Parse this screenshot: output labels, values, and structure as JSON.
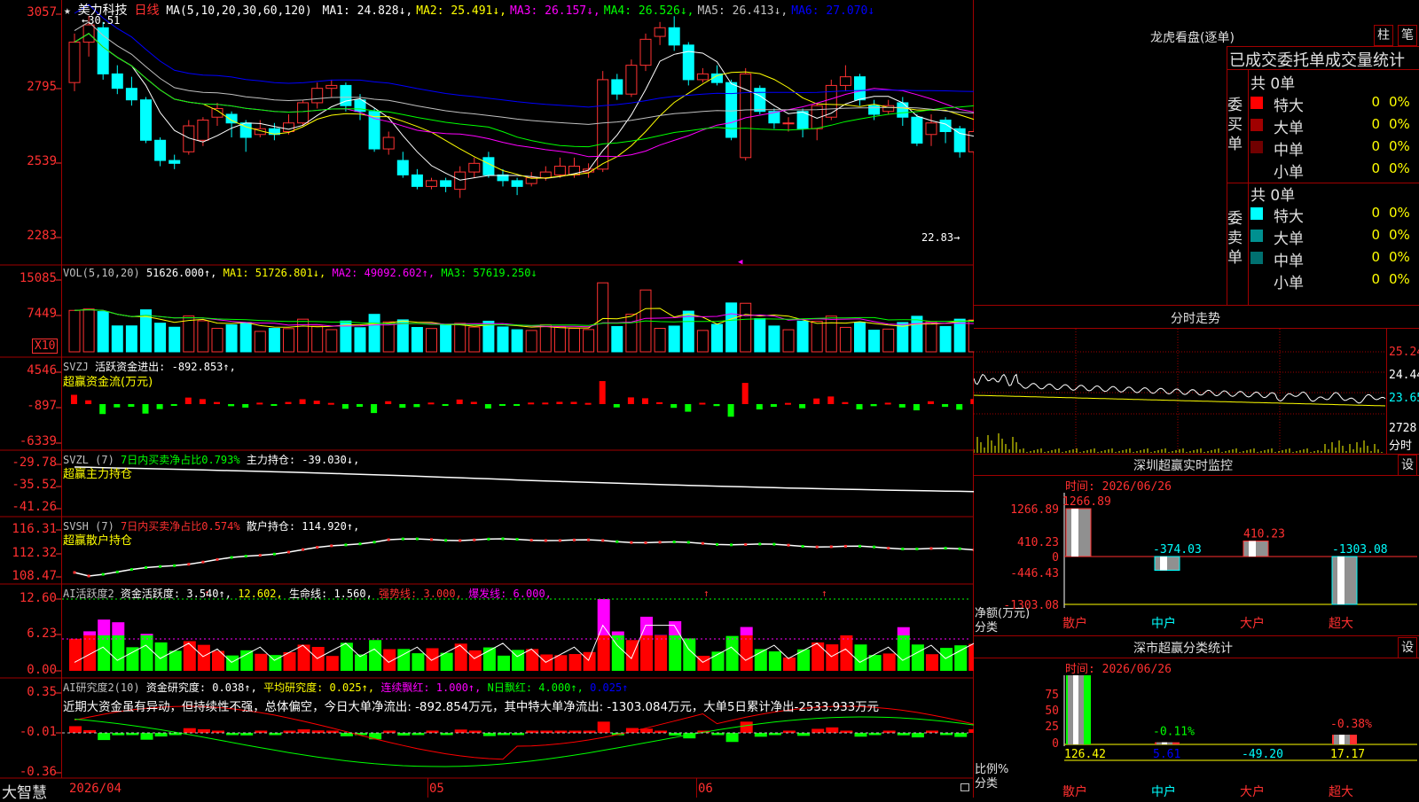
{
  "header": {
    "star": "★",
    "stock_name": "美力科技",
    "period": "日线",
    "ma_params": "MA(5,10,20,30,60,120)",
    "ma_items": [
      {
        "label": "MA1: 24.828↓,",
        "color": "#ffffff"
      },
      {
        "label": "MA2: 25.491↓,",
        "color": "#ffff00"
      },
      {
        "label": "MA3: 26.157↓,",
        "color": "#ff00ff"
      },
      {
        "label": "MA4: 26.526↓,",
        "color": "#00ff00"
      },
      {
        "label": "MA5: 26.413↓,",
        "color": "#c0c0c0"
      },
      {
        "label": "MA6: 27.070↓",
        "color": "#0000ff"
      }
    ],
    "high_marker": "←30.51",
    "low_marker": "22.83→"
  },
  "price_axis": [
    "3057",
    "2795",
    "2539",
    "2283"
  ],
  "vol": {
    "header": "VOL(5,10,20)",
    "value": "51626.000↑,",
    "ma1": "MA1: 51726.801↓,",
    "ma2": "MA2: 49092.602↑,",
    "ma3": "MA3: 57619.250↓",
    "axis": [
      "15085",
      "7449"
    ],
    "unit": "X10"
  },
  "svzj": {
    "name": "SVZJ",
    "label1": "活跃资金进出: -892.853↑,",
    "label2": "超赢资金流(万元)",
    "axis": [
      "4546",
      "-897",
      "-6339"
    ]
  },
  "svzl": {
    "name": "SVZL (7)",
    "label1": "7日内买卖净占比0.793%",
    "label2": "主力持仓: -39.030↓,",
    "label3": "超赢主力持仓",
    "axis": [
      "-29.78",
      "-35.52",
      "-41.26"
    ]
  },
  "svsh": {
    "name": "SVSH (7)",
    "label1": "7日内买卖净占比0.574%",
    "label2": "散户持仓: 114.920↑,",
    "label3": "超赢散户持仓",
    "axis": [
      "116.31",
      "112.32",
      "108.47"
    ]
  },
  "ai1": {
    "name": "AI活跃度2",
    "label1": "资金活跃度: 3.540↑,",
    "label2": "12.602,",
    "label3": "生命线: 1.560,",
    "label4": "强势线: 3.000,",
    "label5": "爆发线: 6.000,",
    "axis": [
      "12.60",
      "6.23",
      "0.00"
    ]
  },
  "ai2": {
    "name": "AI研究度2(10)",
    "label1": "资金研究度: 0.038↑,",
    "label2": "平均研究度: 0.025↑,",
    "label3": "连续飘红: 1.000↑,",
    "label4": "N日飘红: 4.000↑,",
    "label5": "0.025↑",
    "text": "近期大资金虽有异动，但持续性不强，总体偏空，今日大单净流出: -892.854万元，其中特大单净流出: -1303.084万元，大单5日累计净出-2533.933万元",
    "axis": [
      "0.35",
      "-0.01",
      "-0.36"
    ]
  },
  "date_axis": {
    "brand": "大智慧",
    "start": "2026/04",
    "m05": "05",
    "m06": "06"
  },
  "right_panel": {
    "title": "龙虎看盘(逐单)",
    "btn1": "柱",
    "btn2": "笔",
    "subtitle": "已成交委托单成交量统计",
    "buy_label": "委买单",
    "sell_label": "委卖单",
    "buy_total": "共 0单",
    "sell_total": "共 0单",
    "buy_rows": [
      {
        "name": "特大",
        "v1": "0",
        "v2": "0%",
        "color": "#ff0000"
      },
      {
        "name": "大单",
        "v1": "0",
        "v2": "0%",
        "color": "#a00000"
      },
      {
        "name": "中单",
        "v1": "0",
        "v2": "0%",
        "color": "#700000"
      },
      {
        "name": "小单",
        "v1": "0",
        "v2": "0%",
        "color": "#000000"
      }
    ],
    "sell_rows": [
      {
        "name": "特大",
        "v1": "0",
        "v2": "0%",
        "color": "#00ffff"
      },
      {
        "name": "大单",
        "v1": "0",
        "v2": "0%",
        "color": "#009090"
      },
      {
        "name": "中单",
        "v1": "0",
        "v2": "0%",
        "color": "#007070"
      },
      {
        "name": "小单",
        "v1": "0",
        "v2": "0%",
        "color": "#000000"
      }
    ],
    "intraday": {
      "title": "分时走势",
      "axis": [
        "25.24",
        "24.44",
        "23.65",
        "2728"
      ],
      "vol_label": "分时"
    },
    "monitor": {
      "title": "深圳超赢实时监控",
      "btn": "设",
      "time": "时间: 2026/06/26",
      "axis": [
        "1266.89",
        "410.23",
        "0",
        "-446.43",
        "-1303.08"
      ],
      "ylabel": "净额(万元)",
      "xlabel": "分类",
      "categories": [
        "散户",
        "中户",
        "大户",
        "超大"
      ],
      "values": [
        1266.89,
        -374.03,
        410.23,
        -1303.08
      ],
      "value_labels": [
        "1266.89",
        "-374.03",
        "410.23",
        "-1303.08"
      ]
    },
    "classify": {
      "title": "深市超赢分类统计",
      "btn": "设",
      "time": "时间: 2026/06/26",
      "axis": [
        "75",
        "50",
        "25",
        "0"
      ],
      "ylabel": "比例%",
      "xlabel": "分类",
      "categories": [
        "散户",
        "中户",
        "大户",
        "超大"
      ],
      "top_labels": [
        "",
        "-0.11%",
        "",
        "-0.38%"
      ],
      "bottom_labels": [
        "126.42",
        "5.61",
        "-49.20",
        "17.17"
      ],
      "bar_values": [
        100,
        3,
        0,
        14
      ]
    }
  },
  "chart_data": {
    "type": "candlestick",
    "title": "美力科技 日线",
    "candles": [
      {
        "o": 28.2,
        "c": 29.6,
        "h": 29.9,
        "l": 27.9
      },
      {
        "o": 29.6,
        "c": 30.2,
        "h": 30.51,
        "l": 29.1
      },
      {
        "o": 30.1,
        "c": 28.5,
        "h": 30.3,
        "l": 28.3
      },
      {
        "o": 28.5,
        "c": 28.0,
        "h": 28.8,
        "l": 27.8
      },
      {
        "o": 28.0,
        "c": 27.6,
        "h": 28.4,
        "l": 27.4
      },
      {
        "o": 27.6,
        "c": 26.2,
        "h": 27.7,
        "l": 26.1
      },
      {
        "o": 26.2,
        "c": 25.5,
        "h": 26.3,
        "l": 25.3
      },
      {
        "o": 25.5,
        "c": 25.4,
        "h": 25.7,
        "l": 25.2
      },
      {
        "o": 25.8,
        "c": 26.7,
        "h": 26.9,
        "l": 25.7
      },
      {
        "o": 26.2,
        "c": 26.9,
        "h": 27.0,
        "l": 26.0
      },
      {
        "o": 27.0,
        "c": 27.3,
        "h": 27.5,
        "l": 26.7
      },
      {
        "o": 27.1,
        "c": 26.8,
        "h": 27.2,
        "l": 26.3
      },
      {
        "o": 26.8,
        "c": 26.3,
        "h": 26.9,
        "l": 25.8
      },
      {
        "o": 26.4,
        "c": 26.6,
        "h": 26.9,
        "l": 26.3
      },
      {
        "o": 26.6,
        "c": 26.4,
        "h": 26.8,
        "l": 26.2
      },
      {
        "o": 26.5,
        "c": 26.8,
        "h": 27.1,
        "l": 26.4
      },
      {
        "o": 26.8,
        "c": 27.5,
        "h": 27.6,
        "l": 26.7
      },
      {
        "o": 27.5,
        "c": 28.0,
        "h": 28.2,
        "l": 27.3
      },
      {
        "o": 28.0,
        "c": 28.1,
        "h": 28.3,
        "l": 27.7
      },
      {
        "o": 28.1,
        "c": 27.4,
        "h": 28.2,
        "l": 27.2
      },
      {
        "o": 27.6,
        "c": 27.2,
        "h": 27.8,
        "l": 26.9
      },
      {
        "o": 27.2,
        "c": 25.9,
        "h": 27.3,
        "l": 25.8
      },
      {
        "o": 25.9,
        "c": 26.3,
        "h": 26.5,
        "l": 25.7
      },
      {
        "o": 25.5,
        "c": 25.0,
        "h": 25.8,
        "l": 24.9
      },
      {
        "o": 25.0,
        "c": 24.6,
        "h": 25.2,
        "l": 24.5
      },
      {
        "o": 24.6,
        "c": 24.8,
        "h": 24.9,
        "l": 24.5
      },
      {
        "o": 24.8,
        "c": 24.6,
        "h": 24.9,
        "l": 24.4
      },
      {
        "o": 24.5,
        "c": 25.1,
        "h": 25.3,
        "l": 24.2
      },
      {
        "o": 25.1,
        "c": 25.4,
        "h": 25.6,
        "l": 24.9
      },
      {
        "o": 25.6,
        "c": 25.0,
        "h": 25.8,
        "l": 24.9
      },
      {
        "o": 25.0,
        "c": 24.8,
        "h": 25.2,
        "l": 24.6
      },
      {
        "o": 24.8,
        "c": 24.6,
        "h": 24.9,
        "l": 24.3
      },
      {
        "o": 24.7,
        "c": 24.9,
        "h": 25.1,
        "l": 24.6
      },
      {
        "o": 24.9,
        "c": 25.1,
        "h": 25.3,
        "l": 24.8
      },
      {
        "o": 25.0,
        "c": 25.3,
        "h": 25.6,
        "l": 24.9
      },
      {
        "o": 25.0,
        "c": 25.3,
        "h": 25.6,
        "l": 24.9
      },
      {
        "o": 25.1,
        "c": 25.2,
        "h": 25.4,
        "l": 24.9
      },
      {
        "o": 25.2,
        "c": 28.3,
        "h": 28.6,
        "l": 25.1
      },
      {
        "o": 28.3,
        "c": 27.8,
        "h": 28.5,
        "l": 27.6
      },
      {
        "o": 27.8,
        "c": 28.8,
        "h": 29.0,
        "l": 27.7
      },
      {
        "o": 28.8,
        "c": 29.7,
        "h": 29.9,
        "l": 28.6
      },
      {
        "o": 29.8,
        "c": 30.1,
        "h": 30.3,
        "l": 29.5
      },
      {
        "o": 30.1,
        "c": 29.5,
        "h": 30.5,
        "l": 29.3
      },
      {
        "o": 29.5,
        "c": 28.3,
        "h": 29.6,
        "l": 28.1
      },
      {
        "o": 28.3,
        "c": 28.5,
        "h": 28.7,
        "l": 28.2
      },
      {
        "o": 28.5,
        "c": 28.2,
        "h": 28.8,
        "l": 28.1
      },
      {
        "o": 28.2,
        "c": 26.3,
        "h": 28.3,
        "l": 26.2
      },
      {
        "o": 25.6,
        "c": 28.5,
        "h": 28.7,
        "l": 25.5
      },
      {
        "o": 28.0,
        "c": 27.2,
        "h": 28.1,
        "l": 27.1
      },
      {
        "o": 27.2,
        "c": 26.8,
        "h": 27.3,
        "l": 26.6
      },
      {
        "o": 26.8,
        "c": 26.8,
        "h": 27.0,
        "l": 26.5
      },
      {
        "o": 27.2,
        "c": 26.6,
        "h": 27.3,
        "l": 26.3
      },
      {
        "o": 26.6,
        "c": 27.4,
        "h": 27.5,
        "l": 26.2
      },
      {
        "o": 27.0,
        "c": 28.1,
        "h": 28.3,
        "l": 26.9
      },
      {
        "o": 28.1,
        "c": 28.4,
        "h": 28.8,
        "l": 27.9
      },
      {
        "o": 28.4,
        "c": 27.6,
        "h": 28.5,
        "l": 27.4
      },
      {
        "o": 27.4,
        "c": 27.1,
        "h": 27.6,
        "l": 26.9
      },
      {
        "o": 27.2,
        "c": 27.4,
        "h": 27.6,
        "l": 27.1
      },
      {
        "o": 27.5,
        "c": 27.0,
        "h": 27.7,
        "l": 26.7
      },
      {
        "o": 27.0,
        "c": 26.1,
        "h": 27.1,
        "l": 26.0
      },
      {
        "o": 26.4,
        "c": 26.8,
        "h": 27.1,
        "l": 26.0
      },
      {
        "o": 26.9,
        "c": 26.5,
        "h": 27.0,
        "l": 26.1
      },
      {
        "o": 26.6,
        "c": 25.8,
        "h": 26.7,
        "l": 25.6
      },
      {
        "o": 25.8,
        "c": 26.5,
        "h": 26.6,
        "l": 25.7
      },
      {
        "o": 26.5,
        "c": 26.0,
        "h": 26.6,
        "l": 25.5
      },
      {
        "o": 25.8,
        "c": 24.4,
        "h": 25.9,
        "l": 24.3
      },
      {
        "o": 24.4,
        "c": 22.83,
        "h": 24.6,
        "l": 22.83
      }
    ]
  }
}
